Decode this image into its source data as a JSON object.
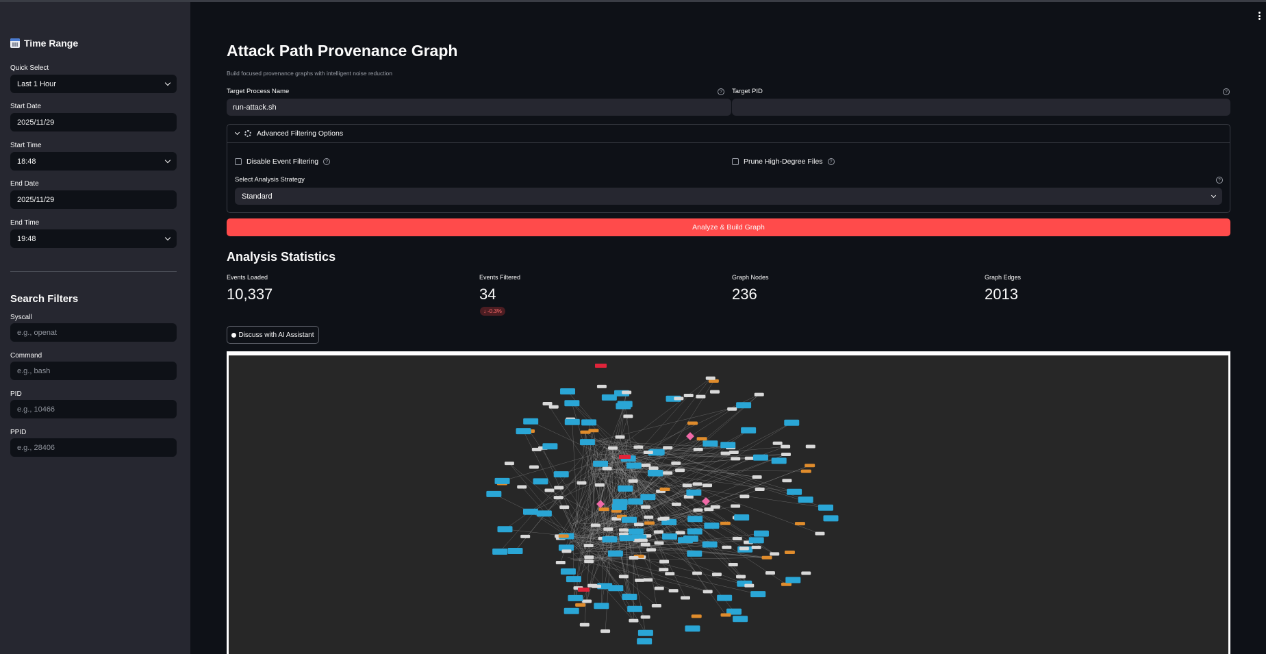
{
  "sidebar": {
    "time_range": {
      "title": "Time Range",
      "quick_select_label": "Quick Select",
      "quick_select_value": "Last 1 Hour",
      "start_date_label": "Start Date",
      "start_date_value": "2025/11/29",
      "start_time_label": "Start Time",
      "start_time_value": "18:48",
      "end_date_label": "End Date",
      "end_date_value": "2025/11/29",
      "end_time_label": "End Time",
      "end_time_value": "19:48"
    },
    "search_filters": {
      "title": "Search Filters",
      "syscall_label": "Syscall",
      "syscall_placeholder": "e.g., openat",
      "command_label": "Command",
      "command_placeholder": "e.g., bash",
      "pid_label": "PID",
      "pid_placeholder": "e.g., 10466",
      "ppid_label": "PPID",
      "ppid_placeholder": "e.g., 28406"
    }
  },
  "main": {
    "title": "Attack Path Provenance Graph",
    "subtitle": "Build focused provenance graphs with intelligent noise reduction",
    "target_process_label": "Target Process Name",
    "target_process_value": "run-attack.sh",
    "target_pid_label": "Target PID",
    "target_pid_value": "",
    "help_glyph": "?",
    "advanced": {
      "title": "Advanced Filtering Options",
      "disable_filtering_label": "Disable Event Filtering",
      "prune_label": "Prune High-Degree Files",
      "strategy_label": "Select Analysis Strategy",
      "strategy_value": "Standard"
    },
    "analyze_button": "Analyze & Build Graph",
    "stats": {
      "title": "Analysis Statistics",
      "events_loaded_label": "Events Loaded",
      "events_loaded_value": "10,337",
      "events_filtered_label": "Events Filtered",
      "events_filtered_value": "34",
      "events_filtered_delta": "-0.3%",
      "delta_arrow": "↓",
      "graph_nodes_label": "Graph Nodes",
      "graph_nodes_value": "236",
      "graph_edges_label": "Graph Edges",
      "graph_edges_value": "2013"
    },
    "ai_button": "Discuss with AI Assistant"
  },
  "graph": {
    "node_colors": {
      "process": "#2aa6d6",
      "file": "#e08c2c",
      "other": "#d9d9d9",
      "alert": "#e0243a",
      "special": "#f06aa8",
      "background": "#272727"
    }
  },
  "icons": {
    "calendar": "calendar-icon",
    "gear": "gear-icon",
    "help": "help-icon",
    "chevron": "chevron-down-icon",
    "robot": "robot-icon",
    "menu": "kebab-menu-icon"
  }
}
